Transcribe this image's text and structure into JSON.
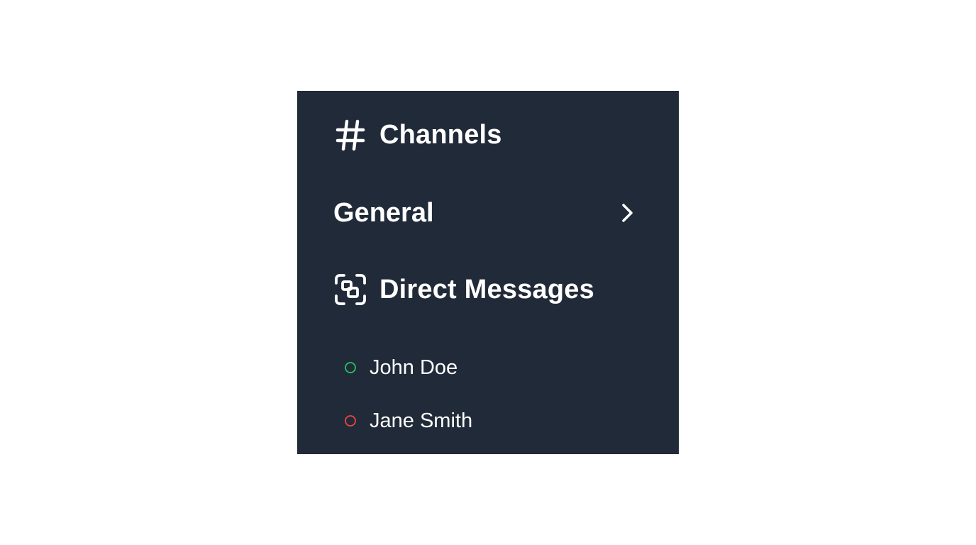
{
  "sidebar": {
    "channels_header": {
      "label": "Channels",
      "icon": "hash-icon"
    },
    "channels": [
      {
        "label": "General",
        "icon": "chevron-right-icon"
      }
    ],
    "direct_messages_header": {
      "label": "Direct Messages",
      "icon": "scan-user-icon"
    },
    "direct_messages": [
      {
        "label": "John Doe",
        "status": "online",
        "status_color": "#22c55e"
      },
      {
        "label": "Jane Smith",
        "status": "offline",
        "status_color": "#ef4444"
      }
    ]
  },
  "colors": {
    "panel_background": "#212a38",
    "text": "#ffffff",
    "page_background": "#ffffff"
  }
}
